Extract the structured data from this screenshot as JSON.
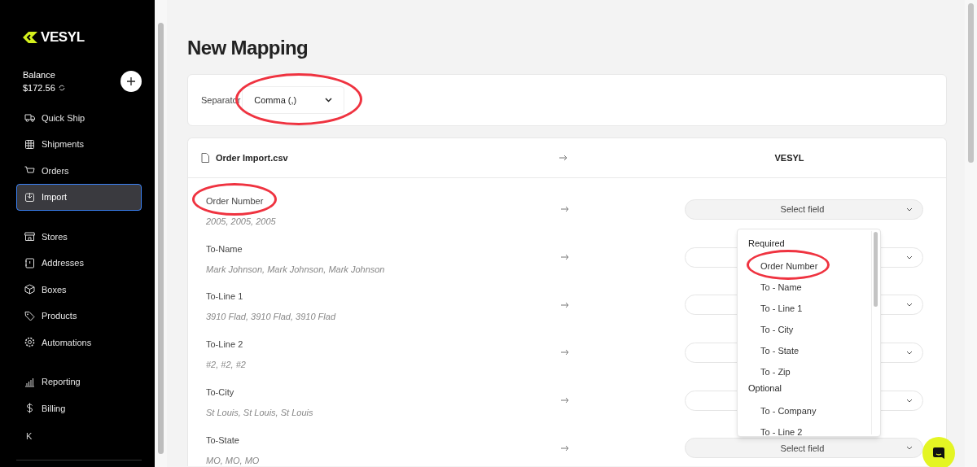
{
  "brand": {
    "name": "VESYL"
  },
  "balance": {
    "label": "Balance",
    "amount": "$172.56"
  },
  "nav_groups": [
    [
      {
        "label": "Quick Ship",
        "selected": false
      },
      {
        "label": "Shipments",
        "selected": false
      },
      {
        "label": "Orders",
        "selected": false
      },
      {
        "label": "Import",
        "selected": true
      }
    ],
    [
      {
        "label": "Stores",
        "selected": false
      },
      {
        "label": "Addresses",
        "selected": false
      },
      {
        "label": "Boxes",
        "selected": false
      },
      {
        "label": "Products",
        "selected": false
      },
      {
        "label": "Automations",
        "selected": false
      }
    ],
    [
      {
        "label": "Reporting",
        "selected": false
      },
      {
        "label": "Billing",
        "selected": false
      }
    ]
  ],
  "collapse": {
    "glyph": "K"
  },
  "page_title": "New Mapping",
  "separator": {
    "label": "Separator",
    "value": "Comma (,)",
    "circled": true
  },
  "mapping": {
    "source": "Order Import.csv",
    "target": "VESYL",
    "rows": [
      {
        "column": "Order Number",
        "sample": "2005, 2005, 2005",
        "field": "Select field",
        "circled": true
      },
      {
        "column": "To-Name",
        "sample": "Mark Johnson, Mark Johnson, Mark Johnson",
        "circled": false
      },
      {
        "column": "To-Line 1",
        "sample": "3910 Flad, 3910 Flad, 3910 Flad",
        "circled": false
      },
      {
        "column": "To-Line 2",
        "sample": "#2, #2, #2",
        "circled": false
      },
      {
        "column": "To-City",
        "sample": "St Louis, St Louis, St Louis",
        "circled": false
      },
      {
        "column": "To-State",
        "sample": "MO, MO, MO",
        "field": "Select field",
        "circled": false
      }
    ]
  },
  "field_menu": {
    "groups": [
      {
        "heading": "Required",
        "options": [
          {
            "label": "Order Number",
            "circled": true
          },
          {
            "label": "To - Name",
            "circled": false
          },
          {
            "label": "To - Line 1",
            "circled": false
          },
          {
            "label": "To - City",
            "circled": false
          },
          {
            "label": "To - State",
            "circled": false
          },
          {
            "label": "To - Zip",
            "circled": false
          }
        ]
      },
      {
        "heading": "Optional",
        "options": [
          {
            "label": "To - Company",
            "circled": false
          },
          {
            "label": "To - Line 2",
            "circled": false
          }
        ]
      }
    ]
  }
}
